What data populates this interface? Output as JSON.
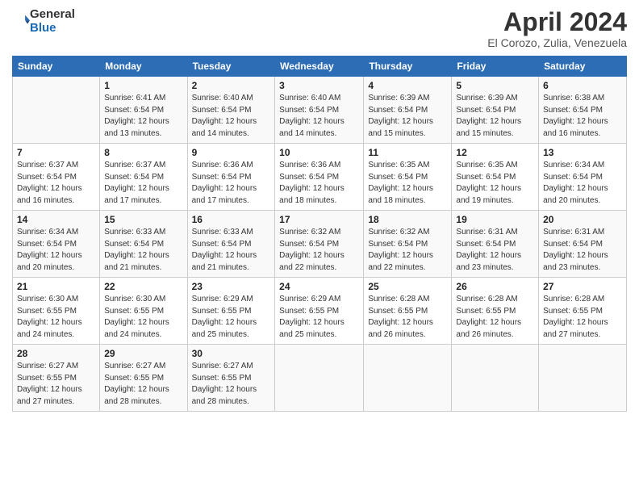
{
  "logo": {
    "general": "General",
    "blue": "Blue"
  },
  "header": {
    "month": "April 2024",
    "location": "El Corozo, Zulia, Venezuela"
  },
  "days_of_week": [
    "Sunday",
    "Monday",
    "Tuesday",
    "Wednesday",
    "Thursday",
    "Friday",
    "Saturday"
  ],
  "weeks": [
    [
      {
        "day": "",
        "sunrise": "",
        "sunset": "",
        "daylight": ""
      },
      {
        "day": "1",
        "sunrise": "Sunrise: 6:41 AM",
        "sunset": "Sunset: 6:54 PM",
        "daylight": "Daylight: 12 hours and 13 minutes."
      },
      {
        "day": "2",
        "sunrise": "Sunrise: 6:40 AM",
        "sunset": "Sunset: 6:54 PM",
        "daylight": "Daylight: 12 hours and 14 minutes."
      },
      {
        "day": "3",
        "sunrise": "Sunrise: 6:40 AM",
        "sunset": "Sunset: 6:54 PM",
        "daylight": "Daylight: 12 hours and 14 minutes."
      },
      {
        "day": "4",
        "sunrise": "Sunrise: 6:39 AM",
        "sunset": "Sunset: 6:54 PM",
        "daylight": "Daylight: 12 hours and 15 minutes."
      },
      {
        "day": "5",
        "sunrise": "Sunrise: 6:39 AM",
        "sunset": "Sunset: 6:54 PM",
        "daylight": "Daylight: 12 hours and 15 minutes."
      },
      {
        "day": "6",
        "sunrise": "Sunrise: 6:38 AM",
        "sunset": "Sunset: 6:54 PM",
        "daylight": "Daylight: 12 hours and 16 minutes."
      }
    ],
    [
      {
        "day": "7",
        "sunrise": "Sunrise: 6:37 AM",
        "sunset": "Sunset: 6:54 PM",
        "daylight": "Daylight: 12 hours and 16 minutes."
      },
      {
        "day": "8",
        "sunrise": "Sunrise: 6:37 AM",
        "sunset": "Sunset: 6:54 PM",
        "daylight": "Daylight: 12 hours and 17 minutes."
      },
      {
        "day": "9",
        "sunrise": "Sunrise: 6:36 AM",
        "sunset": "Sunset: 6:54 PM",
        "daylight": "Daylight: 12 hours and 17 minutes."
      },
      {
        "day": "10",
        "sunrise": "Sunrise: 6:36 AM",
        "sunset": "Sunset: 6:54 PM",
        "daylight": "Daylight: 12 hours and 18 minutes."
      },
      {
        "day": "11",
        "sunrise": "Sunrise: 6:35 AM",
        "sunset": "Sunset: 6:54 PM",
        "daylight": "Daylight: 12 hours and 18 minutes."
      },
      {
        "day": "12",
        "sunrise": "Sunrise: 6:35 AM",
        "sunset": "Sunset: 6:54 PM",
        "daylight": "Daylight: 12 hours and 19 minutes."
      },
      {
        "day": "13",
        "sunrise": "Sunrise: 6:34 AM",
        "sunset": "Sunset: 6:54 PM",
        "daylight": "Daylight: 12 hours and 20 minutes."
      }
    ],
    [
      {
        "day": "14",
        "sunrise": "Sunrise: 6:34 AM",
        "sunset": "Sunset: 6:54 PM",
        "daylight": "Daylight: 12 hours and 20 minutes."
      },
      {
        "day": "15",
        "sunrise": "Sunrise: 6:33 AM",
        "sunset": "Sunset: 6:54 PM",
        "daylight": "Daylight: 12 hours and 21 minutes."
      },
      {
        "day": "16",
        "sunrise": "Sunrise: 6:33 AM",
        "sunset": "Sunset: 6:54 PM",
        "daylight": "Daylight: 12 hours and 21 minutes."
      },
      {
        "day": "17",
        "sunrise": "Sunrise: 6:32 AM",
        "sunset": "Sunset: 6:54 PM",
        "daylight": "Daylight: 12 hours and 22 minutes."
      },
      {
        "day": "18",
        "sunrise": "Sunrise: 6:32 AM",
        "sunset": "Sunset: 6:54 PM",
        "daylight": "Daylight: 12 hours and 22 minutes."
      },
      {
        "day": "19",
        "sunrise": "Sunrise: 6:31 AM",
        "sunset": "Sunset: 6:54 PM",
        "daylight": "Daylight: 12 hours and 23 minutes."
      },
      {
        "day": "20",
        "sunrise": "Sunrise: 6:31 AM",
        "sunset": "Sunset: 6:54 PM",
        "daylight": "Daylight: 12 hours and 23 minutes."
      }
    ],
    [
      {
        "day": "21",
        "sunrise": "Sunrise: 6:30 AM",
        "sunset": "Sunset: 6:55 PM",
        "daylight": "Daylight: 12 hours and 24 minutes."
      },
      {
        "day": "22",
        "sunrise": "Sunrise: 6:30 AM",
        "sunset": "Sunset: 6:55 PM",
        "daylight": "Daylight: 12 hours and 24 minutes."
      },
      {
        "day": "23",
        "sunrise": "Sunrise: 6:29 AM",
        "sunset": "Sunset: 6:55 PM",
        "daylight": "Daylight: 12 hours and 25 minutes."
      },
      {
        "day": "24",
        "sunrise": "Sunrise: 6:29 AM",
        "sunset": "Sunset: 6:55 PM",
        "daylight": "Daylight: 12 hours and 25 minutes."
      },
      {
        "day": "25",
        "sunrise": "Sunrise: 6:28 AM",
        "sunset": "Sunset: 6:55 PM",
        "daylight": "Daylight: 12 hours and 26 minutes."
      },
      {
        "day": "26",
        "sunrise": "Sunrise: 6:28 AM",
        "sunset": "Sunset: 6:55 PM",
        "daylight": "Daylight: 12 hours and 26 minutes."
      },
      {
        "day": "27",
        "sunrise": "Sunrise: 6:28 AM",
        "sunset": "Sunset: 6:55 PM",
        "daylight": "Daylight: 12 hours and 27 minutes."
      }
    ],
    [
      {
        "day": "28",
        "sunrise": "Sunrise: 6:27 AM",
        "sunset": "Sunset: 6:55 PM",
        "daylight": "Daylight: 12 hours and 27 minutes."
      },
      {
        "day": "29",
        "sunrise": "Sunrise: 6:27 AM",
        "sunset": "Sunset: 6:55 PM",
        "daylight": "Daylight: 12 hours and 28 minutes."
      },
      {
        "day": "30",
        "sunrise": "Sunrise: 6:27 AM",
        "sunset": "Sunset: 6:55 PM",
        "daylight": "Daylight: 12 hours and 28 minutes."
      },
      {
        "day": "",
        "sunrise": "",
        "sunset": "",
        "daylight": ""
      },
      {
        "day": "",
        "sunrise": "",
        "sunset": "",
        "daylight": ""
      },
      {
        "day": "",
        "sunrise": "",
        "sunset": "",
        "daylight": ""
      },
      {
        "day": "",
        "sunrise": "",
        "sunset": "",
        "daylight": ""
      }
    ]
  ]
}
